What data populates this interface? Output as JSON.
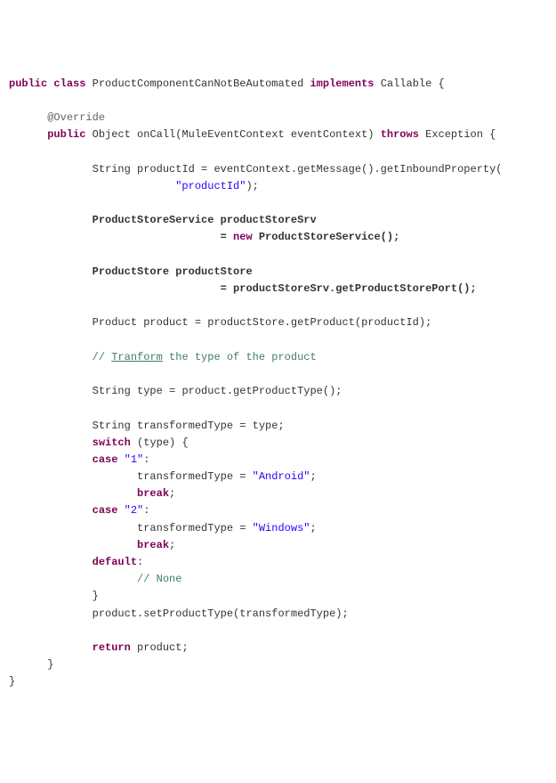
{
  "kw": {
    "public1": "public",
    "class": "class",
    "implements": "implements",
    "public2": "public",
    "throws": "throws",
    "new": "new",
    "switch": "switch",
    "case1": "case",
    "case2": "case",
    "break1": "break",
    "break2": "break",
    "default": "default",
    "return": "return"
  },
  "txt": {
    "classname": " ProductComponentCanNotBeAutomated ",
    "callable": " Callable {",
    "override": "@Override",
    "method_sig1": " Object onCall(MuleEventContext eventContext) ",
    "method_sig2": " Exception {",
    "l1": "String productId = eventContext.getMessage().getInboundProperty(",
    "l1b": ");",
    "l2a": "ProductStoreService productStoreSrv",
    "l2b": "= ",
    "l2c": " ProductStoreService();",
    "l3a": "ProductStore productStore",
    "l3b": "= productStoreSrv.getProductStorePort();",
    "l4": "Product product = productStore.getProduct(productId);",
    "com1a": "// ",
    "com1u": "Tranform",
    "com1b": " the type of the product",
    "l5": "String type = product.getProductType();",
    "l6": "String transformedType = type;",
    "l7": " (type) {",
    "colon": ":",
    "c1body": "transformedType = ",
    "semi": ";",
    "c2body": "transformedType = ",
    "com2": "// None",
    "brace": "}",
    "l8": "product.setProductType(transformedType);",
    "l9": " product;"
  },
  "str": {
    "productId": "\"productId\"",
    "one": "\"1\"",
    "two": "\"2\"",
    "android": "\"Android\"",
    "windows": "\"Windows\""
  }
}
